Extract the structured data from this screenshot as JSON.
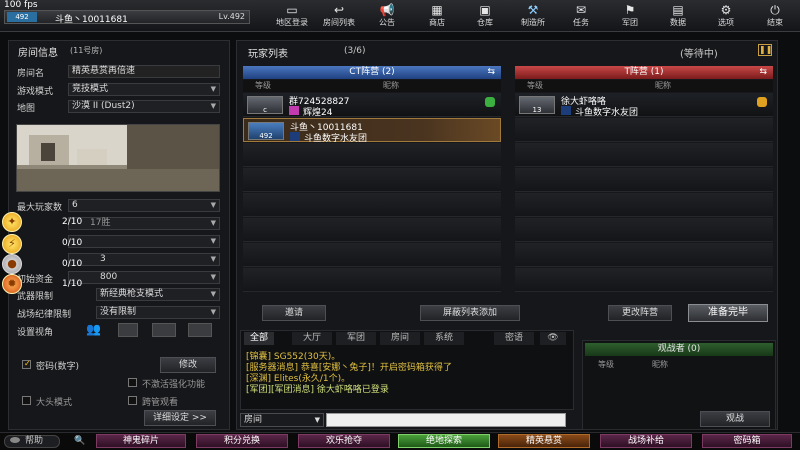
{
  "fps": "100 fps",
  "player": {
    "name": "斗鱼丶10011681",
    "level": "Lv.492",
    "badge": "492"
  },
  "nav": [
    {
      "label": "地区登录",
      "icon": "screen-icon"
    },
    {
      "label": "房间列表",
      "icon": "back-arrow-icon"
    },
    {
      "label": "公告",
      "icon": "megaphone-icon"
    },
    {
      "label": "商店",
      "icon": "shop-icon"
    },
    {
      "label": "仓库",
      "icon": "briefcase-icon"
    },
    {
      "label": "制造所",
      "icon": "hammer-icon"
    },
    {
      "label": "任务",
      "icon": "task-icon"
    },
    {
      "label": "军团",
      "icon": "flag-icon"
    },
    {
      "label": "数据",
      "icon": "chart-icon"
    },
    {
      "label": "选项",
      "icon": "gear-icon"
    },
    {
      "label": "结束",
      "icon": "power-icon"
    }
  ],
  "room": {
    "header": "房间信息",
    "number": "(11号房)",
    "name_label": "房间名",
    "name_value": "精英悬赏再倍速",
    "mode_label": "游戏模式",
    "mode_value": "竞技模式",
    "map_label": "地图",
    "map_value": "沙漠 II (Dust2)",
    "max_players_label": "最大玩家数",
    "max_players_value": "6",
    "target_value": "17胜",
    "time_value": "3",
    "money_label": "初始资金",
    "money_value": "800",
    "weapon_label": "武器限制",
    "weapon_value": "新经典枪支模式",
    "discipline_label": "战场纪律限制",
    "discipline_value": "没有限制",
    "view_label": "设置视角",
    "password_label": "密码(数字)",
    "modify_btn": "修改",
    "no_enhance_label": "不激活强化功能",
    "big_head_label": "大头模式",
    "spectate_label": "跨管观看",
    "detail_btn": "详细设定 >>",
    "hud": [
      {
        "value": "2/10"
      },
      {
        "value": "0/10"
      },
      {
        "value": "0/10"
      },
      {
        "value": "1/10"
      }
    ]
  },
  "players": {
    "title": "玩家列表",
    "count": "(3/6)",
    "status": "(等待中)",
    "ct_header": "CT阵营 (2)",
    "t_header": "T阵营 (1)",
    "col_level": "等级",
    "col_name": "昵称",
    "ct": [
      {
        "badge": "c",
        "name": "群724528827",
        "clan": "辉煌24"
      },
      {
        "badge": "492",
        "name": "斗鱼丶10011681",
        "clan": "斗鱼数字水友团"
      }
    ],
    "t": [
      {
        "badge": "13",
        "name": "徐大虾咯咯",
        "clan": "斗鱼数字水友团"
      }
    ]
  },
  "actions": {
    "invite": "邀请",
    "block": "屏蔽列表添加",
    "change_team": "更改阵营",
    "ready": "准备完毕"
  },
  "chat": {
    "tabs": [
      "全部",
      "大厅",
      "军团",
      "房间",
      "系统",
      "密语"
    ],
    "lines": [
      {
        "text": "[锦囊] SG552(30天)。",
        "color": "#e0c040"
      },
      {
        "text": "[服务器消息] 恭喜[安娜丶兔子]！开启密码箱获得了",
        "color": "#e0c040"
      },
      {
        "text": "[深渊] Elites(永久/1个)。",
        "color": "#e0c040"
      },
      {
        "text": "[军团][军团消息] 徐大虾咯咯已登录",
        "color": "#cfe07a"
      }
    ],
    "channel": "房间"
  },
  "observer": {
    "header": "观战者 (0)",
    "col_level": "等级",
    "col_name": "昵称",
    "btn": "观战"
  },
  "bottom": {
    "help": "帮助",
    "buttons": [
      "神鬼碎片",
      "积分兑换",
      "欢乐抢夺",
      "绝地探索",
      "精英悬赏",
      "战场补给",
      "密码箱"
    ]
  }
}
